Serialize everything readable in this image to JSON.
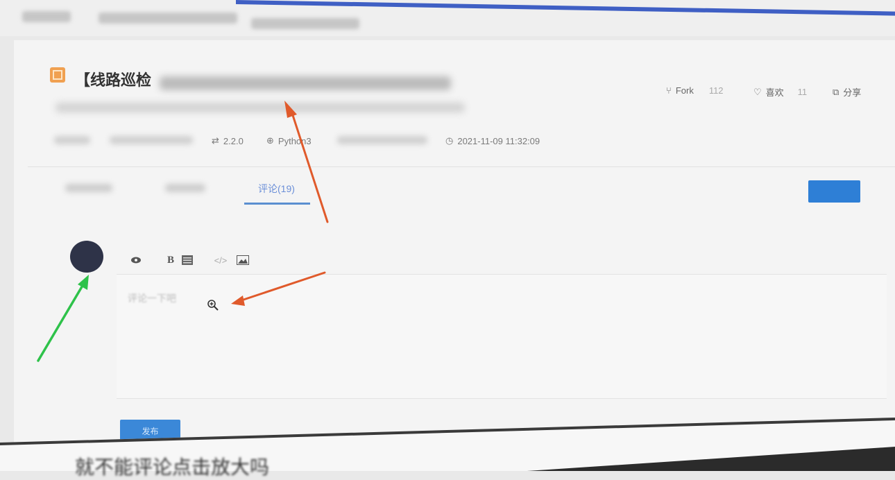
{
  "header": {
    "title_prefix": "【线路巡检",
    "actions": [
      {
        "icon": "fork-icon",
        "label": "Fork",
        "count": "112"
      },
      {
        "icon": "heart-icon",
        "label": "喜欢",
        "count": "11"
      },
      {
        "icon": "share-icon",
        "label": "分享",
        "count": ""
      }
    ]
  },
  "meta": {
    "version": "2.2.0",
    "language": "Python3",
    "timestamp": "2021-11-09 11:32:09"
  },
  "tabs": [
    {
      "label": "",
      "active": false
    },
    {
      "label": "",
      "active": false
    },
    {
      "label": "评论(19)",
      "active": true
    }
  ],
  "buttons": {
    "top_right": "",
    "submit": "发布"
  },
  "editor": {
    "placeholder": "评论一下吧",
    "toolbar": [
      "eye-icon",
      "bold-icon",
      "list-icon",
      "code-icon",
      "image-icon"
    ]
  },
  "caption": "就不能评论点击放大吗",
  "colors": {
    "accent": "#3f5fc4",
    "primary_button": "#2e7fd6",
    "tab_active": "#5b8fd0",
    "annotation_red": "#e05a2b",
    "annotation_green": "#2ec24a"
  }
}
